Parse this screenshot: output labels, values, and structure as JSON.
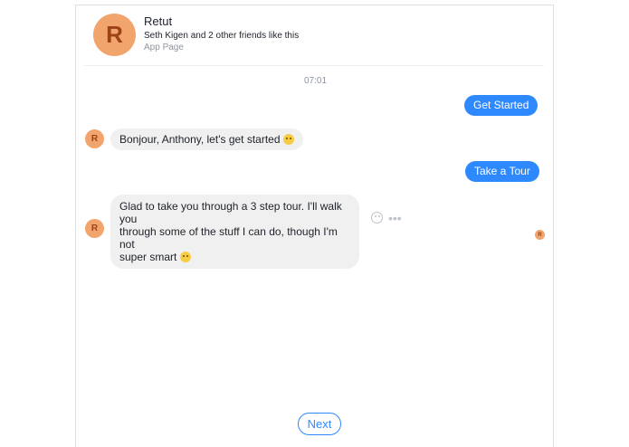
{
  "header": {
    "avatar_letter": "R",
    "page_name": "Retut",
    "likes_text": "Seth Kigen and 2 other friends like this",
    "page_type": "App Page"
  },
  "conversation": {
    "timestamp": "07:01",
    "messages": [
      {
        "from": "user",
        "text": "Get Started"
      },
      {
        "from": "bot",
        "text": "Bonjour, Anthony, let's get started"
      },
      {
        "from": "user",
        "text": "Take a Tour"
      },
      {
        "from": "bot",
        "text_lines": [
          "Glad to take you through a 3 step tour. I'll walk you",
          "through some of the stuff I can do, though I'm not",
          "super smart"
        ]
      }
    ],
    "bot_avatar_letter": "R"
  },
  "actions": {
    "next_label": "Next",
    "more_icon": "•••"
  },
  "colors": {
    "accent": "#2e89ff",
    "avatar_bg": "#f2a46d",
    "avatar_fg": "#9e4318",
    "bubble_in": "#f1f0f0"
  }
}
